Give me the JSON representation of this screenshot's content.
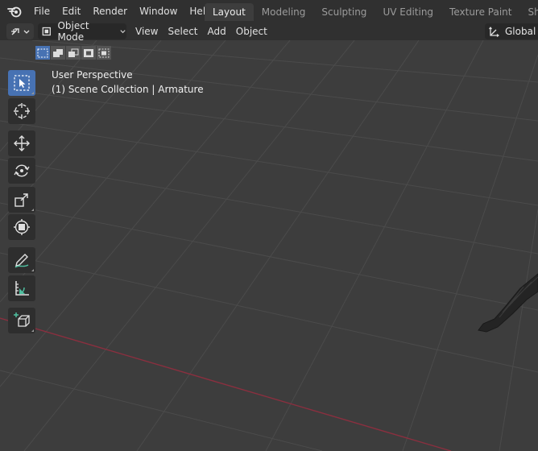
{
  "menubar": {
    "items": [
      "File",
      "Edit",
      "Render",
      "Window",
      "Help"
    ]
  },
  "workspaces": {
    "tabs": [
      "Layout",
      "Modeling",
      "Sculpting",
      "UV Editing",
      "Texture Paint",
      "Shading"
    ],
    "active": "Layout"
  },
  "viewport_header": {
    "mode": "Object Mode",
    "menu": [
      "View",
      "Select",
      "Add",
      "Object"
    ],
    "orientation": "Global"
  },
  "overlay": {
    "perspective": "User Perspective",
    "collection": "(1) Scene Collection | Armature"
  },
  "toolbar": {
    "tools": [
      "select-box",
      "cursor",
      "move",
      "rotate",
      "scale",
      "transform",
      "annotate",
      "measure",
      "add-cube"
    ],
    "active": "select-box"
  },
  "colors": {
    "accent": "#4772b3",
    "x_axis": "#8a2f3f",
    "grid": "#4a4a4a"
  }
}
